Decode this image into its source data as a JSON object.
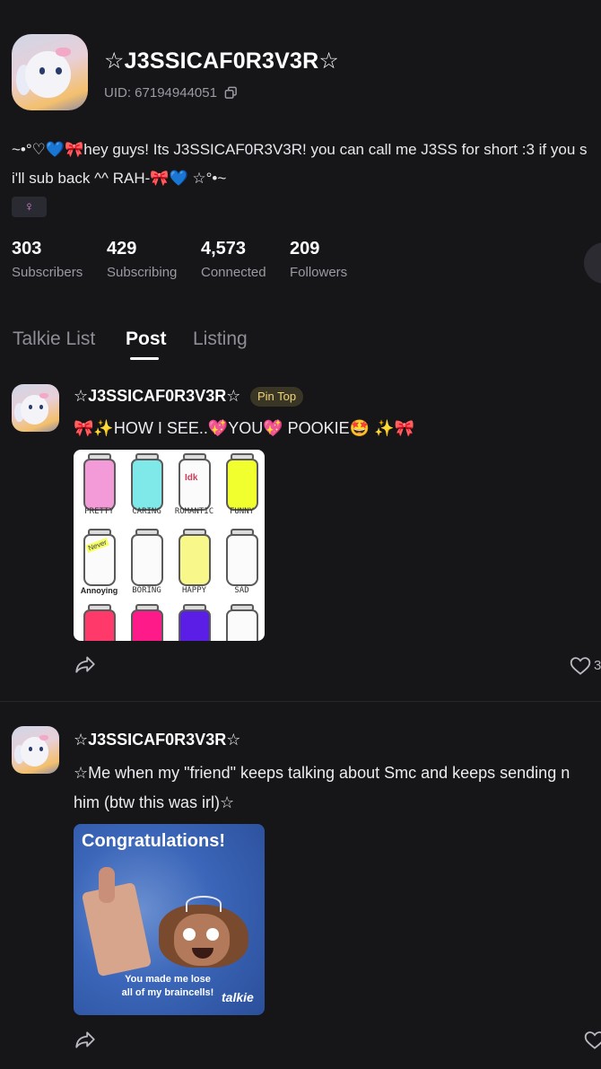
{
  "profile": {
    "username": "☆J3SSICAF0R3V3R☆",
    "uid": "UID: 67194944051",
    "bio_line1": "~•°♡💙🎀hey guys! Its J3SSICAF0R3V3R! you can call me J3SS for short :3 if you s",
    "bio_line2": "i'll sub back ^^ RAH-🎀💙 ☆°•~",
    "gender_badge": "♀"
  },
  "stats": [
    {
      "value": "303",
      "label": "Subscribers"
    },
    {
      "value": "429",
      "label": "Subscribing"
    },
    {
      "value": "4,573",
      "label": "Connected"
    },
    {
      "value": "209",
      "label": "Followers"
    }
  ],
  "tabs": [
    {
      "label": "Talkie List"
    },
    {
      "label": "Post"
    },
    {
      "label": "Listing"
    }
  ],
  "posts": [
    {
      "author": "☆J3SSICAF0R3V3R☆",
      "pin_label": "Pin Top",
      "text_line1": "🎀✨HOW I SEE..💖YOU💖 POOKIE🤩 ✨🎀",
      "image_jars": [
        "PRETTY",
        "CARING",
        "ROMANTIC",
        "FUNNY",
        "Annoying",
        "BORING",
        "HAPPY",
        "SAD"
      ],
      "jar_text_idk": "Idk",
      "jar_text_never": "Never",
      "like_count": "3"
    },
    {
      "author": "☆J3SSICAF0R3V3R☆",
      "text_line1": "☆Me when my \"friend\" keeps talking about Smc and keeps sending n",
      "text_line2": "him (btw this was irl)☆",
      "image_title": "Congratulations!",
      "image_caption": "You made me lose all of my braincells!",
      "image_logo": "talkie"
    }
  ],
  "colors": {
    "background": "#161619",
    "muted_text": "#9a9aa2",
    "pin_badge_text": "#f1d478",
    "gender_badge": "#d78bd8"
  }
}
